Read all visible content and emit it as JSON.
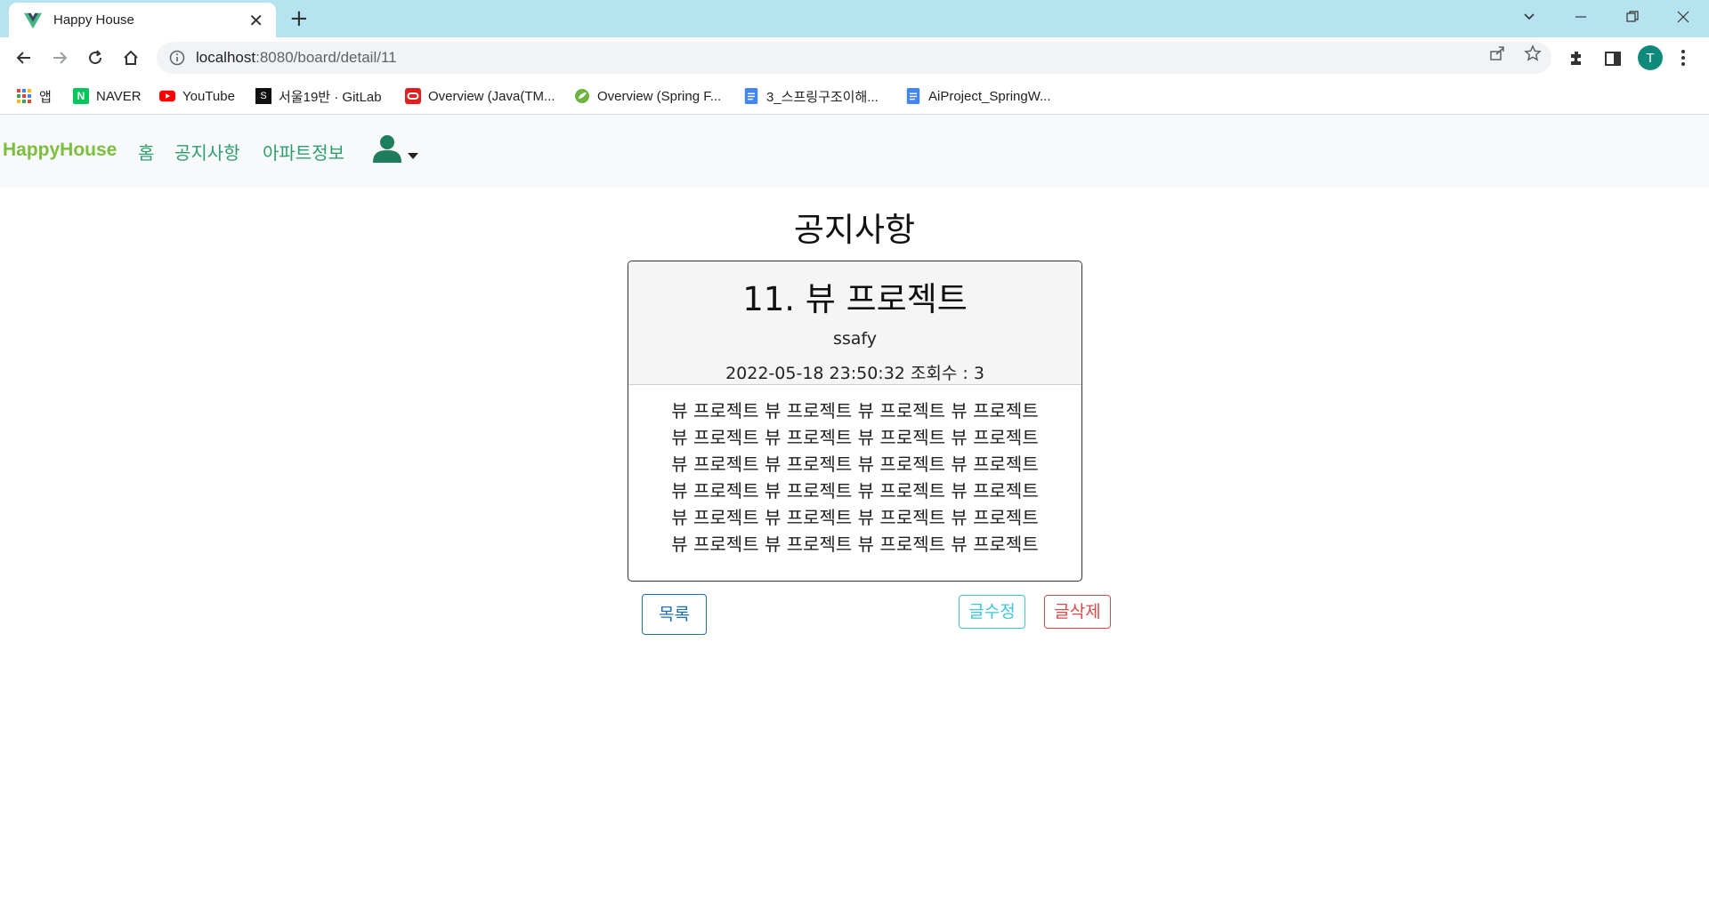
{
  "browser": {
    "tab_title": "Happy House",
    "new_tab_label": "+",
    "url_host": "localhost",
    "url_rest": ":8080/board/detail/11",
    "profile_initial": "T",
    "bookmarks": [
      {
        "label": "앱",
        "icon": "apps-grid-icon"
      },
      {
        "label": "NAVER",
        "icon": "naver-icon"
      },
      {
        "label": "YouTube",
        "icon": "youtube-icon"
      },
      {
        "label": "서울19반 · GitLab",
        "icon": "gitlab-icon"
      },
      {
        "label": "Overview (Java(TM...",
        "icon": "oracle-icon"
      },
      {
        "label": "Overview (Spring F...",
        "icon": "spring-icon"
      },
      {
        "label": "3_스프링구조이해...",
        "icon": "docs-icon"
      },
      {
        "label": "AiProject_SpringW...",
        "icon": "docs-icon"
      }
    ]
  },
  "navbar": {
    "brand": "HappyHouse",
    "links": [
      "홈",
      "공지사항",
      "아파트정보"
    ]
  },
  "page": {
    "title": "공지사항"
  },
  "article": {
    "title": "11. 뷰 프로젝트",
    "author": "ssafy",
    "meta": "2022-05-18 23:50:32 조회수 : 3",
    "content_lines": [
      "뷰 프로젝트 뷰 프로젝트 뷰 프로젝트 뷰 프로젝트",
      "뷰 프로젝트 뷰 프로젝트 뷰 프로젝트 뷰 프로젝트",
      "뷰 프로젝트 뷰 프로젝트 뷰 프로젝트 뷰 프로젝트",
      "뷰 프로젝트 뷰 프로젝트 뷰 프로젝트 뷰 프로젝트",
      "뷰 프로젝트 뷰 프로젝트 뷰 프로젝트 뷰 프로젝트",
      "뷰 프로젝트 뷰 프로젝트 뷰 프로젝트 뷰 프로젝트"
    ]
  },
  "actions": {
    "list_label": "목록",
    "edit_label": "글수정",
    "delete_label": "글삭제"
  },
  "colors": {
    "tabstrip": "#b5e3ef",
    "brand": "#7cbe3f",
    "nav_link": "#2e9e6e",
    "btn_list": "#1f6fb5",
    "btn_edit": "#3cc7d9",
    "btn_delete": "#e04848"
  }
}
